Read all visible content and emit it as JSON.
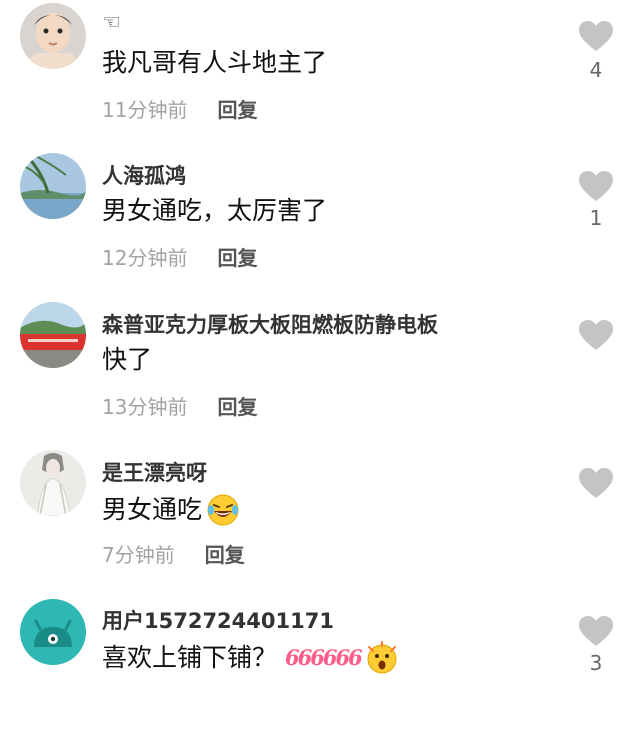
{
  "comments": [
    {
      "username": "☜",
      "content": "我凡哥有人斗地主了",
      "time": "11分钟前",
      "reply": "回复",
      "likes": "4"
    },
    {
      "username": "人海孤鸿",
      "content": "男女通吃，太厉害了",
      "time": "12分钟前",
      "reply": "回复",
      "likes": "1"
    },
    {
      "username": "森普亚克力厚板大板阻燃板防静电板",
      "content": "快了",
      "time": "13分钟前",
      "reply": "回复",
      "likes": ""
    },
    {
      "username": "是王漂亮呀",
      "content": "男女通吃",
      "content_emoji": "laughing-crying-emoji",
      "time": "7分钟前",
      "reply": "回复",
      "likes": ""
    },
    {
      "username": "用户1572724401171",
      "content": "喜欢上铺下铺？",
      "content_stickers": "666666",
      "content_emoji": "shocked-emoji",
      "likes": "3"
    }
  ],
  "colors": {
    "heart": "#c4c4c4",
    "time": "#a3a3a3",
    "reply": "#555555",
    "sticker": "#ff5c8a"
  }
}
